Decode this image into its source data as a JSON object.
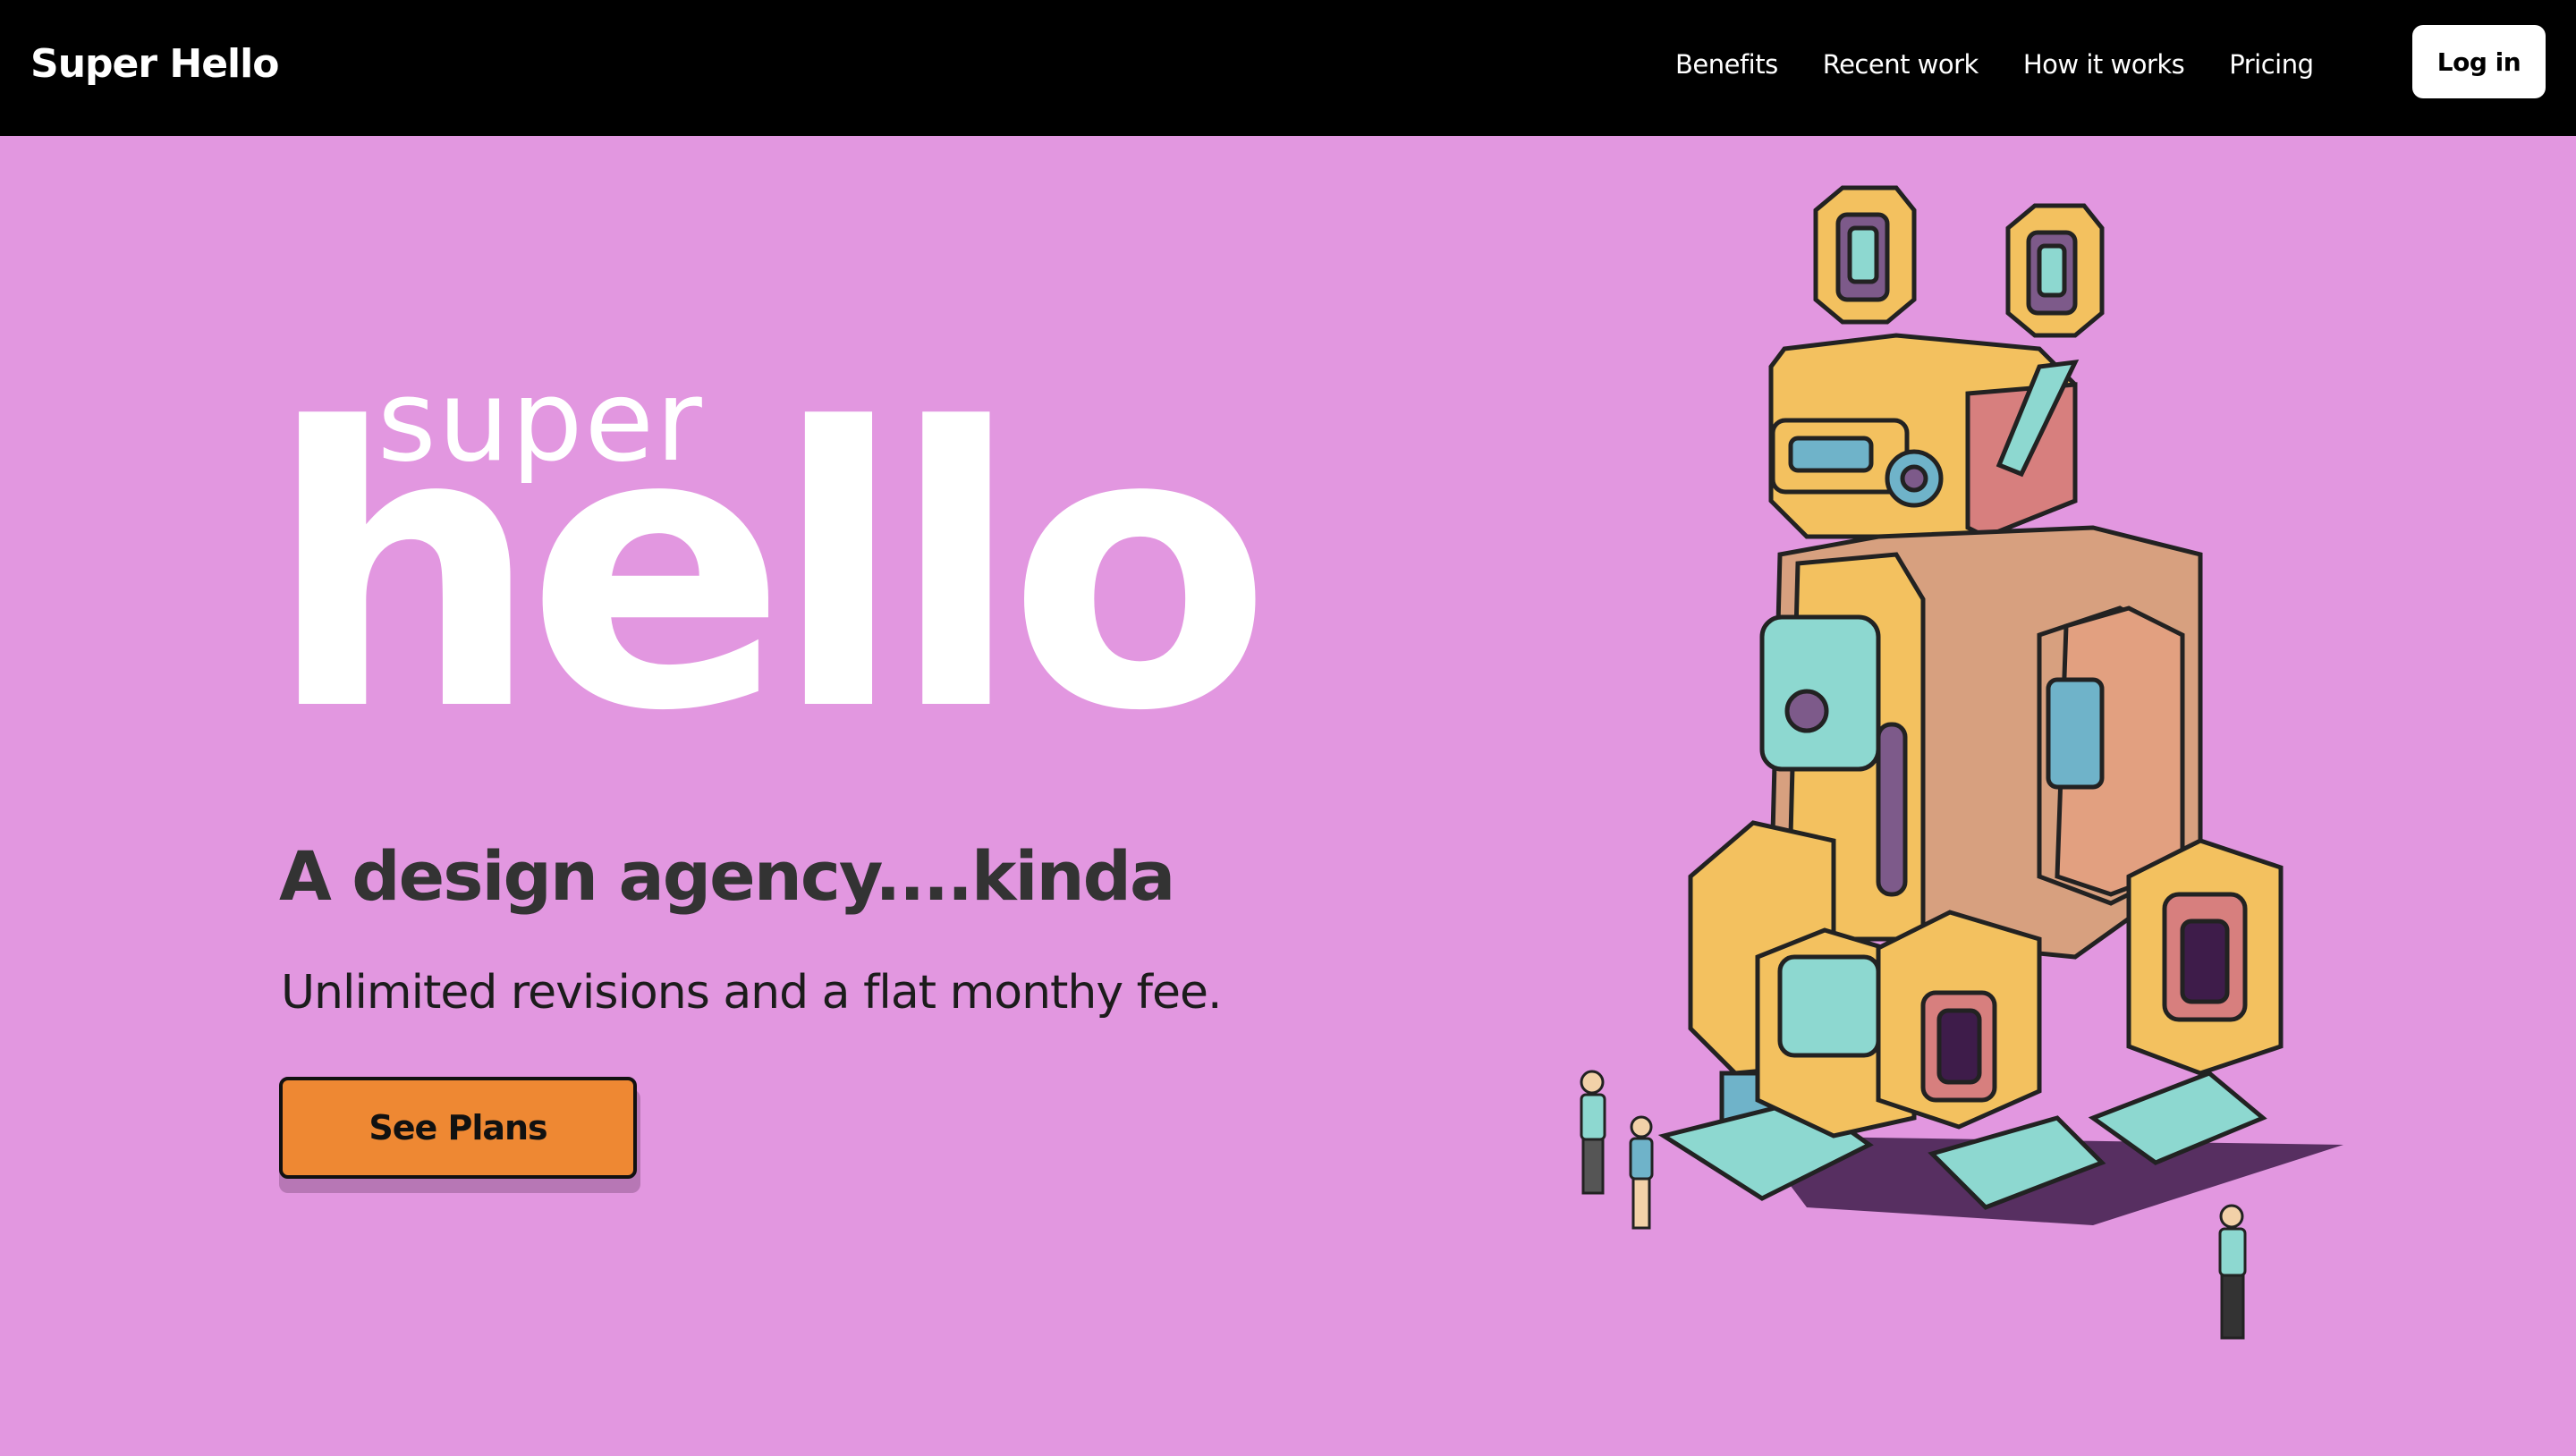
{
  "brand": "Super Hello",
  "nav": {
    "links": [
      "Benefits",
      "Recent work",
      "How it works",
      "Pricing"
    ],
    "login_label": "Log in"
  },
  "hero": {
    "word_small": "super",
    "word_big": "hello",
    "tagline": "A design agency....kinda",
    "subtitle": "Unlimited revisions and a flat monthy fee.",
    "cta_label": "See Plans",
    "illustration": "robot-mech-icon"
  },
  "colors": {
    "nav_bg": "#000000",
    "hero_bg": "#e297e0",
    "cta_bg": "#ee8833",
    "text_dark": "#333333"
  }
}
